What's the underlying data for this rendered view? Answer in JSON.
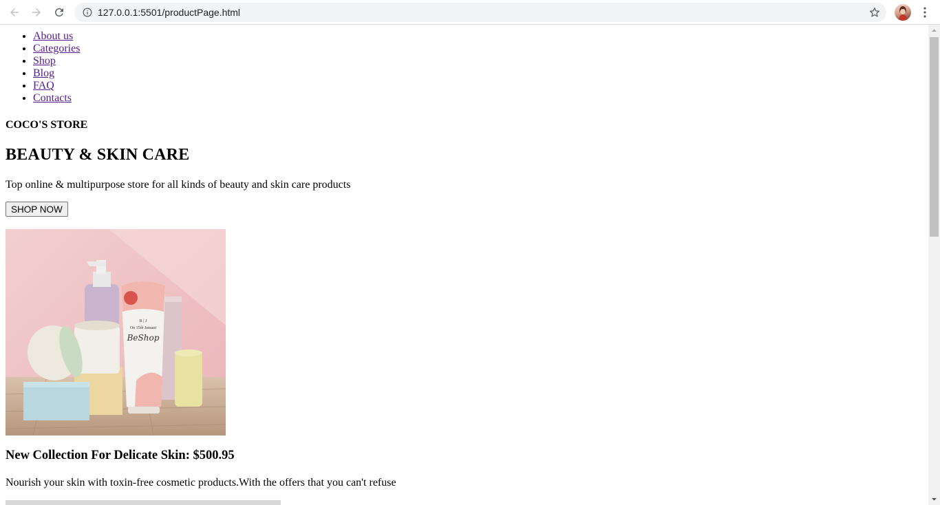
{
  "browser": {
    "url": "127.0.0.1:5501/productPage.html",
    "icons": [
      "back-arrow-icon",
      "forward-arrow-icon",
      "reload-icon",
      "info-icon",
      "star-icon",
      "profile-avatar",
      "kebab-menu-icon"
    ]
  },
  "nav": {
    "items": [
      {
        "label": "About us"
      },
      {
        "label": "Categories"
      },
      {
        "label": "Shop"
      },
      {
        "label": "Blog"
      },
      {
        "label": "FAQ"
      },
      {
        "label": "Contacts"
      }
    ]
  },
  "hero": {
    "store_name": "COCO'S STORE",
    "title": "BEAUTY & SKIN CARE",
    "subtitle": "Top online & multipurpose store for all kinds of beauty and skin care products",
    "button": "SHOP NOW"
  },
  "product": {
    "image_label_brand": "R | J",
    "image_label_text": "BeShop",
    "image_date_text": "On 15th Januari",
    "title": "New Collection For Delicate Skin: $500.95",
    "description": "Nourish your skin with toxin-free cosmetic products.With the offers that you can't refuse"
  },
  "colors": {
    "link": "#551a8b",
    "omnibox": "#f1f3f4"
  }
}
